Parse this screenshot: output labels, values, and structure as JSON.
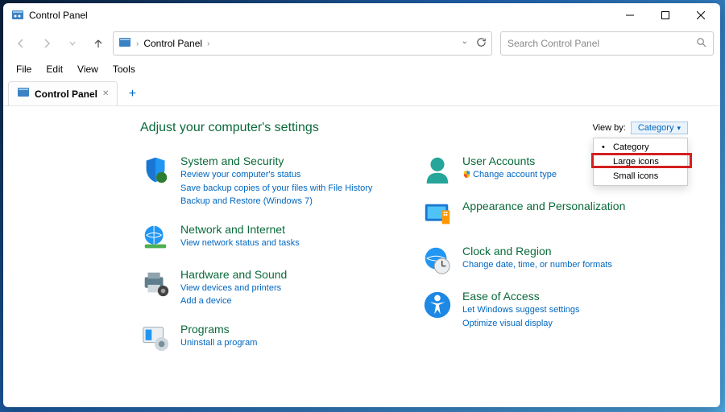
{
  "window": {
    "title": "Control Panel"
  },
  "breadcrumb": {
    "root": "Control Panel"
  },
  "search": {
    "placeholder": "Search Control Panel"
  },
  "menu": {
    "file": "File",
    "edit": "Edit",
    "view": "View",
    "tools": "Tools"
  },
  "tab": {
    "label": "Control Panel"
  },
  "page": {
    "heading": "Adjust your computer's settings",
    "viewby_label": "View by:",
    "viewby_value": "Category",
    "viewby_options": {
      "o0": "Category",
      "o1": "Large icons",
      "o2": "Small icons"
    }
  },
  "left": {
    "c0": {
      "title": "System and Security",
      "l0": "Review your computer's status",
      "l1": "Save backup copies of your files with File History",
      "l2": "Backup and Restore (Windows 7)"
    },
    "c1": {
      "title": "Network and Internet",
      "l0": "View network status and tasks"
    },
    "c2": {
      "title": "Hardware and Sound",
      "l0": "View devices and printers",
      "l1": "Add a device"
    },
    "c3": {
      "title": "Programs",
      "l0": "Uninstall a program"
    }
  },
  "right": {
    "c0": {
      "title": "User Accounts",
      "l0": "Change account type"
    },
    "c1": {
      "title": "Appearance and Personalization"
    },
    "c2": {
      "title": "Clock and Region",
      "l0": "Change date, time, or number formats"
    },
    "c3": {
      "title": "Ease of Access",
      "l0": "Let Windows suggest settings",
      "l1": "Optimize visual display"
    }
  }
}
